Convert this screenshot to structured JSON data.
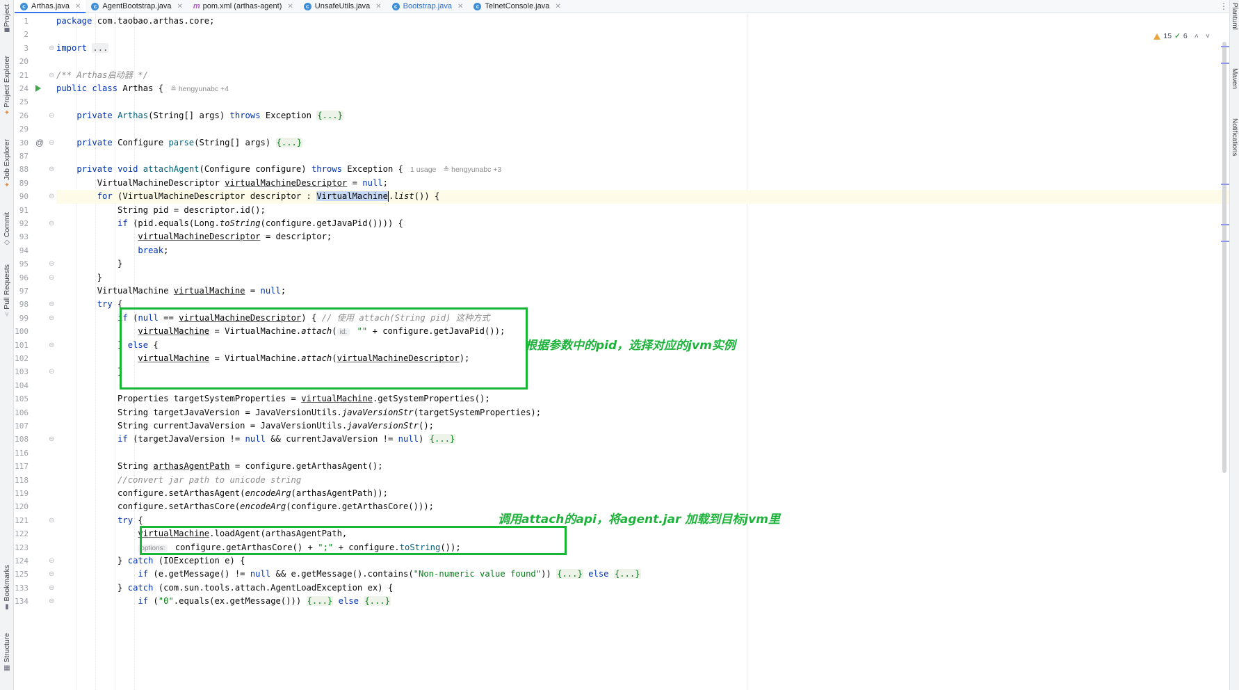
{
  "tabs": [
    {
      "label": "Arthas.java",
      "icon": "java-class-icon",
      "active": true
    },
    {
      "label": "AgentBootstrap.java",
      "icon": "java-class-icon"
    },
    {
      "label": "pom.xml (arthas-agent)",
      "icon": "maven-icon"
    },
    {
      "label": "UnsafeUtils.java",
      "icon": "java-class-icon"
    },
    {
      "label": "Bootstrap.java",
      "icon": "java-class-icon",
      "modified": true
    },
    {
      "label": "TelnetConsole.java",
      "icon": "java-class-icon"
    }
  ],
  "left_tools": [
    "Project",
    "Project Explorer",
    "Job Explorer",
    "Commit",
    "Pull Requests",
    "Bookmarks",
    "Structure"
  ],
  "right_tools": [
    "Maven",
    "Notifications"
  ],
  "right_tools_top": "Plantuml",
  "inspection": {
    "warnings": "15",
    "ok": "6"
  },
  "line_numbers": [
    "1",
    "2",
    "3",
    "20",
    "21",
    "24",
    "25",
    "26",
    "29",
    "30",
    "87",
    "88",
    "89",
    "90",
    "91",
    "92",
    "93",
    "94",
    "95",
    "96",
    "97",
    "98",
    "99",
    "100",
    "101",
    "102",
    "103",
    "104",
    "105",
    "106",
    "107",
    "108",
    "116",
    "117",
    "118",
    "119",
    "120",
    "121",
    "122",
    "123",
    "124",
    "125",
    "133",
    "134"
  ],
  "code": {
    "l1": [
      "package",
      " com.taobao.arthas.core;"
    ],
    "l3": [
      "import",
      " ",
      "..."
    ],
    "l21": "/** Arthas启动器 */",
    "l24": [
      "public",
      " ",
      "class",
      " Arthas {",
      "hengyunabc +4"
    ],
    "l26": [
      "    ",
      "private",
      " ",
      "Arthas",
      "(String[] args) ",
      "throws",
      " Exception ",
      "{...}"
    ],
    "l30": [
      "    ",
      "private",
      " Configure ",
      "parse",
      "(String[] args) ",
      "{...}"
    ],
    "l88": [
      "    ",
      "private",
      " ",
      "void",
      " ",
      "attachAgent",
      "(Configure configure) ",
      "throws",
      " Exception {",
      "1 usage",
      "hengyunabc +3"
    ],
    "l89": [
      "        VirtualMachineDescriptor ",
      "virtualMachineDescriptor",
      " = ",
      "null",
      ";"
    ],
    "l90": [
      "        ",
      "for",
      " (VirtualMachineDescriptor descriptor : ",
      "VirtualMachine",
      ".",
      "list",
      "()) {"
    ],
    "l91": [
      "            String pid = descriptor.id();"
    ],
    "l92": [
      "            ",
      "if",
      " (pid.equals(Long.",
      "toString",
      "(configure.getJavaPid()))) {"
    ],
    "l93": [
      "                ",
      "virtualMachineDescriptor",
      " = descriptor;"
    ],
    "l94": [
      "                ",
      "break",
      ";"
    ],
    "l95": "            }",
    "l96": "        }",
    "l97": [
      "        ",
      "VirtualMachine",
      " ",
      "virtualMachine",
      " = ",
      "null",
      ";"
    ],
    "l98": [
      "        ",
      "try",
      " {"
    ],
    "l99": [
      "            ",
      "if",
      " (",
      "null",
      " == ",
      "virtualMachineDescriptor",
      ") { ",
      "// 使用 attach(String pid) 这种方式"
    ],
    "l100": [
      "                ",
      "virtualMachine",
      " = ",
      "VirtualMachine",
      ".",
      "attach",
      "(",
      "id:",
      " ",
      "\"\"",
      " + configure.getJavaPid());"
    ],
    "l101": [
      "            } ",
      "else",
      " {"
    ],
    "l102": [
      "                ",
      "virtualMachine",
      " = ",
      "VirtualMachine",
      ".",
      "attach",
      "(",
      "virtualMachineDescriptor",
      ");"
    ],
    "l103": "            }",
    "l105": [
      "            Properties targetSystemProperties = ",
      "virtualMachine",
      ".getSystemProperties();"
    ],
    "l106": [
      "            String targetJavaVersion = JavaVersionUtils.",
      "javaVersionStr",
      "(targetSystemProperties);"
    ],
    "l107": [
      "            String currentJavaVersion = JavaVersionUtils.",
      "javaVersionStr",
      "();"
    ],
    "l108": [
      "            ",
      "if",
      " (targetJavaVersion != ",
      "null",
      " && currentJavaVersion != ",
      "null",
      ") ",
      "{...}"
    ],
    "l117": [
      "            String ",
      "arthasAgentPath",
      " = configure.getArthasAgent();"
    ],
    "l118": "            //convert jar path to unicode string",
    "l119": [
      "            configure.setArthasAgent(",
      "encodeArg",
      "(arthasAgentPath));"
    ],
    "l120": [
      "            configure.setArthasCore(",
      "encodeArg",
      "(configure.getArthasCore()));"
    ],
    "l121": [
      "            ",
      "try",
      " {"
    ],
    "l122": [
      "                ",
      "virtualMachine",
      ".loadAgent(arthasAgentPath,"
    ],
    "l123": [
      "                ",
      "options:",
      " configure.getArthasCore() + ",
      "\";\"",
      " + configure.",
      "toString",
      "());"
    ],
    "l124": [
      "            } ",
      "catch",
      " (IOException e) {"
    ],
    "l125": [
      "                ",
      "if",
      " (e.getMessage() != ",
      "null",
      " && e.getMessage().contains(",
      "\"Non-numeric value found\"",
      ")) ",
      "{...}",
      " ",
      "else",
      " ",
      "{...}"
    ],
    "l133": [
      "            } ",
      "catch",
      " (com.sun.tools.attach.AgentLoadException ex) {"
    ],
    "l134": [
      "                ",
      "if",
      " (",
      "\"0\"",
      ".equals(ex.getMessage())) ",
      "{...}",
      " ",
      "else",
      " ",
      "{...}"
    ]
  },
  "annotations": [
    {
      "text": "根据参数中的pid，选择对应的jvm实例",
      "color": "#1db33a"
    },
    {
      "text": "调用attach的api，将agent.jar 加载到目标jvm里",
      "color": "#1db33a"
    }
  ],
  "colors": {
    "keyword": "#0033b3",
    "method": "#00627a",
    "field": "#871094",
    "string": "#067d17",
    "comment": "#8c8c8c",
    "annotation": "#18b634",
    "current_line": "#fefbe8",
    "selection": "#c5d8f5"
  }
}
